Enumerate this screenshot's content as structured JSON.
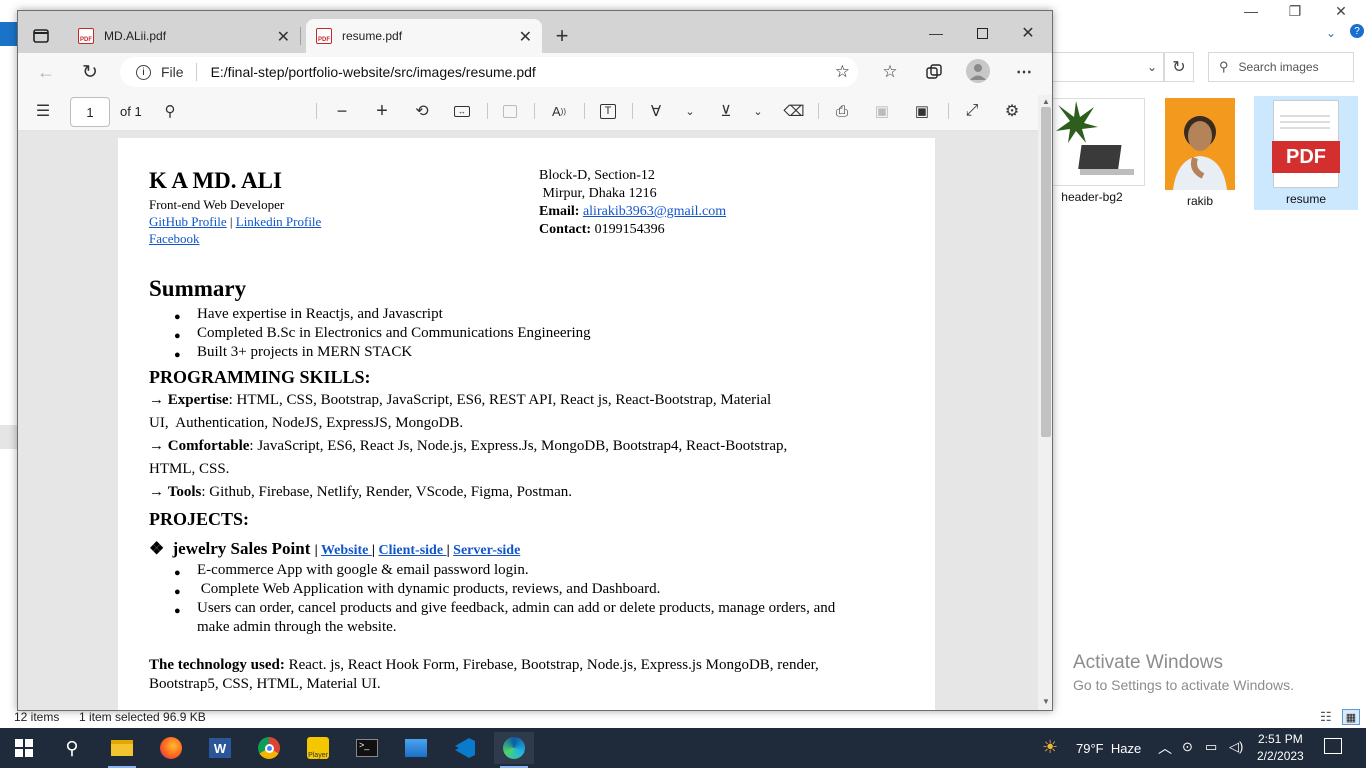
{
  "explorer": {
    "search_placeholder": "Search images",
    "files": [
      {
        "name": "header-bg2",
        "icon": "laptop-plant-thumbnail"
      },
      {
        "name": "rakib",
        "icon": "person-photo-thumbnail"
      },
      {
        "name": "resume",
        "icon": "pdf-file-icon",
        "selected": true
      }
    ],
    "status": {
      "items": "12 items",
      "selected": "1 item selected  96.9 KB"
    },
    "activate_title": "Activate Windows",
    "activate_sub": "Go to Settings to activate Windows."
  },
  "browser": {
    "tabs": [
      {
        "title": "MD.ALii.pdf",
        "active": false
      },
      {
        "title": "resume.pdf",
        "active": true
      }
    ],
    "url_label": "File",
    "url": "E:/final-step/portfolio-website/src/images/resume.pdf",
    "pdf": {
      "page": "1",
      "of": "of 1"
    }
  },
  "resume": {
    "name": "K A MD. ALI",
    "role": "Front-end Web Developer",
    "github": "GitHub Profile",
    "sep": "|",
    "linkedin": "Linkedin Profile",
    "facebook": "Facebook",
    "address1": "Block-D, Section-12",
    "address2": " Mirpur, Dhaka 1216",
    "email_label": "Email:",
    "email": "alirakib3963@gmail.com",
    "contact_label": "Contact:",
    "contact": " 0199154396",
    "summary_title": "Summary",
    "summary": [
      "Have expertise in Reactjs, and Javascript",
      "Completed B.Sc in Electronics and Communications Engineering",
      "Built 3+ projects in MERN STACK"
    ],
    "skills_title": "PROGRAMMING SKILLS:",
    "expertise_label": "Expertise",
    "expertise_1": ": HTML, CSS, Bootstrap, JavaScript, ES6, REST API, React js, React-Bootstrap, Material",
    "expertise_2": "UI,  Authentication, NodeJS, ExpressJS, MongoDB.",
    "comfortable_label": "Comfortable",
    "comfortable_1": ": JavaScript, ES6, React Js, Node.js, Express.Js, MongoDB, Bootstrap4, React-Bootstrap,",
    "comfortable_2": "HTML, CSS.",
    "tools_label": "Tools",
    "tools": ": Github, Firebase, Netlify, Render, VScode, Figma, Postman.",
    "projects_title": "PROJECTS:",
    "project_name": "jewelry Sales Point",
    "project_links": [
      "Website ",
      "Client-side ",
      "Server-side"
    ],
    "project_points": [
      "E-commerce App with google & email password login.",
      " Complete Web Application with dynamic products, reviews, and Dashboard.",
      "Users can order, cancel products and give feedback, admin can add or delete products, manage orders, and",
      "make admin through the website."
    ],
    "tech_label": "The technology used:",
    "tech_1": " React. js, React Hook Form, Firebase, Bootstrap, Node.js, Express.js MongoDB, render,",
    "tech_2": "Bootstrap5, CSS, HTML, Material UI."
  },
  "taskbar": {
    "weather": "79°F  Haze",
    "time": "2:51 PM",
    "date": "2/2/2023",
    "apps": [
      "file-explorer-icon",
      "firefox-icon",
      "word-icon",
      "chrome-icon",
      "player-icon",
      "terminal-icon",
      "photos-icon",
      "vscode-icon",
      "edge-icon"
    ]
  }
}
